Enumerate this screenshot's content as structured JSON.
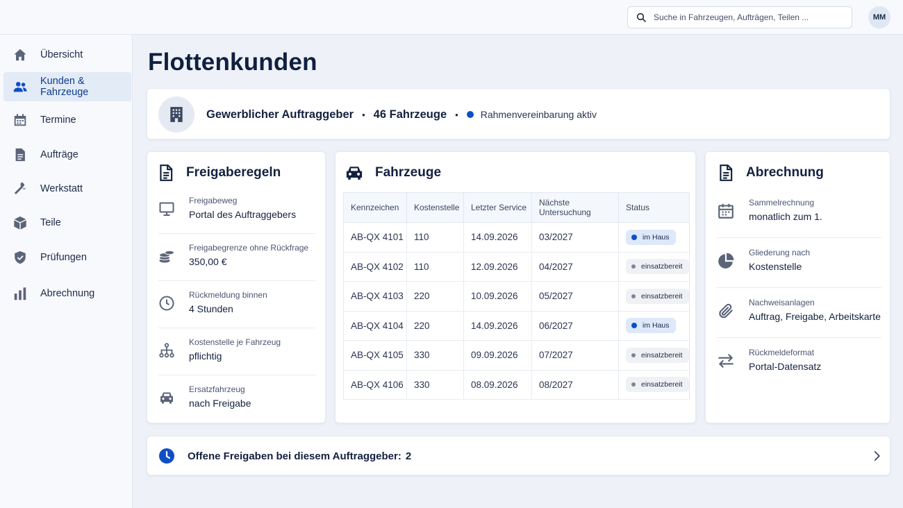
{
  "header": {
    "search_placeholder": "Suche in Fahrzeugen, Aufträgen, Teilen ...",
    "user_initials": "MM"
  },
  "sidebar": {
    "items": [
      {
        "label": "Übersicht",
        "icon": "home-icon"
      },
      {
        "label": "Kunden & Fahrzeuge",
        "icon": "users-icon",
        "active": true
      },
      {
        "label": "Termine",
        "icon": "calendar-icon"
      },
      {
        "label": "Aufträge",
        "icon": "document-icon"
      },
      {
        "label": "Werkstatt",
        "icon": "wrench-icon"
      },
      {
        "label": "Teile",
        "icon": "box-icon"
      },
      {
        "label": "Prüfungen",
        "icon": "shield-icon"
      },
      {
        "label": "Abrechnung",
        "icon": "bar-chart-icon"
      }
    ]
  },
  "page": {
    "title": "Flottenkunden"
  },
  "client": {
    "type": "Gewerblicher Auftraggeber",
    "vehicle_count": "46 Fahrzeuge",
    "contract_status": "Rahmenvereinbarung aktiv",
    "separator": "•"
  },
  "rules": {
    "title": "Freigaberegeln",
    "items": [
      {
        "label": "Freigabeweg",
        "value": "Portal des Auftraggebers",
        "icon": "monitor-icon"
      },
      {
        "label": "Freigabegrenze ohne Rückfrage",
        "value": "350,00 €",
        "icon": "coins-icon"
      },
      {
        "label": "Rückmeldung binnen",
        "value": "4 Stunden",
        "icon": "clock-icon"
      },
      {
        "label": "Kostenstelle je Fahrzeug",
        "value": "pflichtig",
        "icon": "hierarchy-icon"
      },
      {
        "label": "Ersatzfahrzeug",
        "value": "nach Freigabe",
        "icon": "car-icon"
      }
    ]
  },
  "vehicles": {
    "title": "Fahrzeuge",
    "columns": [
      "Kennzeichen",
      "Kostenstelle",
      "Letzter Service",
      "Nächste Untersuchung",
      "Status"
    ],
    "rows": [
      {
        "plate": "AB-QX 4101",
        "cost_center": "110",
        "last_service": "14.09.2026",
        "next_inspection": "03/2027",
        "status": "im Haus",
        "status_kind": "inhouse"
      },
      {
        "plate": "AB-QX 4102",
        "cost_center": "110",
        "last_service": "12.09.2026",
        "next_inspection": "04/2027",
        "status": "einsatzbereit",
        "status_kind": "ready"
      },
      {
        "plate": "AB-QX 4103",
        "cost_center": "220",
        "last_service": "10.09.2026",
        "next_inspection": "05/2027",
        "status": "einsatzbereit",
        "status_kind": "ready"
      },
      {
        "plate": "AB-QX 4104",
        "cost_center": "220",
        "last_service": "14.09.2026",
        "next_inspection": "06/2027",
        "status": "im Haus",
        "status_kind": "inhouse"
      },
      {
        "plate": "AB-QX 4105",
        "cost_center": "330",
        "last_service": "09.09.2026",
        "next_inspection": "07/2027",
        "status": "einsatzbereit",
        "status_kind": "ready"
      },
      {
        "plate": "AB-QX 4106",
        "cost_center": "330",
        "last_service": "08.09.2026",
        "next_inspection": "08/2027",
        "status": "einsatzbereit",
        "status_kind": "ready"
      }
    ]
  },
  "billing": {
    "title": "Abrechnung",
    "items": [
      {
        "label": "Sammelrechnung",
        "value": "monatlich zum 1.",
        "icon": "calendar-icon"
      },
      {
        "label": "Gliederung nach",
        "value": "Kostenstelle",
        "icon": "pie-chart-icon"
      },
      {
        "label": "Nachweisanlagen",
        "value": "Auftrag, Freigabe, Arbeitskarte",
        "icon": "paperclip-icon"
      },
      {
        "label": "Rückmeldeformat",
        "value": "Portal-Datensatz",
        "icon": "swap-arrows-icon"
      }
    ]
  },
  "pending": {
    "label": "Offene Freigaben bei diesem Auftraggeber:",
    "count": "2"
  },
  "colors": {
    "accent": "#0e4fc4",
    "text_dark": "#13213f",
    "icon": "#5b6478",
    "background": "#eef2f8"
  }
}
